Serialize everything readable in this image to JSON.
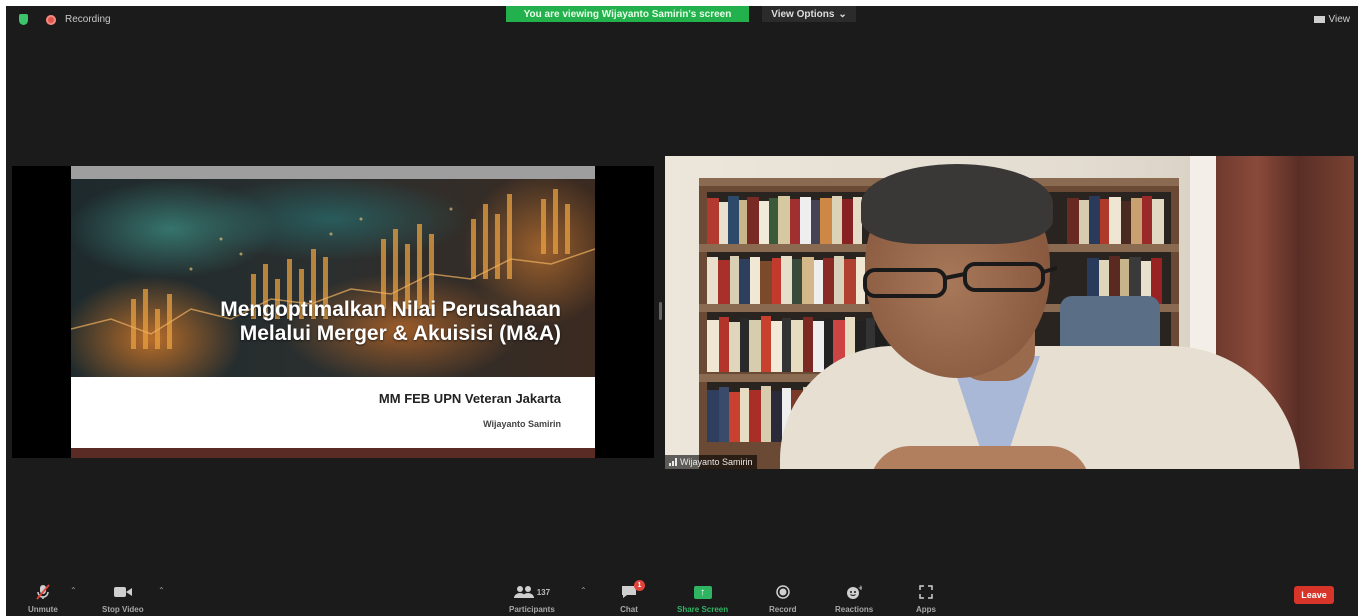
{
  "top_bar": {
    "recording_label": "Recording",
    "viewing_banner": "You are viewing Wijayanto Samirin's screen",
    "view_options_label": "View Options",
    "view_label": "View"
  },
  "slide": {
    "title_line1": "Mengoptimalkan Nilai Perusahaan",
    "title_line2": "Melalui Merger & Akuisisi (M&A)",
    "subtitle": "MM FEB UPN Veteran Jakarta",
    "author": "Wijayanto Samirin"
  },
  "video": {
    "participant_name": "Wijayanto Samirin"
  },
  "toolbar": {
    "unmute_label": "Unmute",
    "stop_video_label": "Stop Video",
    "participants_label": "Participants",
    "participants_count": "137",
    "chat_label": "Chat",
    "chat_badge": "1",
    "share_screen_label": "Share Screen",
    "record_label": "Record",
    "reactions_label": "Reactions",
    "apps_label": "Apps",
    "leave_label": "Leave"
  },
  "colors": {
    "banner_green": "#22b14c",
    "leave_red": "#d8352a",
    "background": "#1b1b1b"
  },
  "icons": [
    "shield-icon",
    "record-icon",
    "grid-icon",
    "microphone-muted-icon",
    "video-camera-icon",
    "participants-icon",
    "chat-icon",
    "share-screen-icon",
    "record-button-icon",
    "reactions-icon",
    "apps-icon",
    "signal-icon"
  ]
}
